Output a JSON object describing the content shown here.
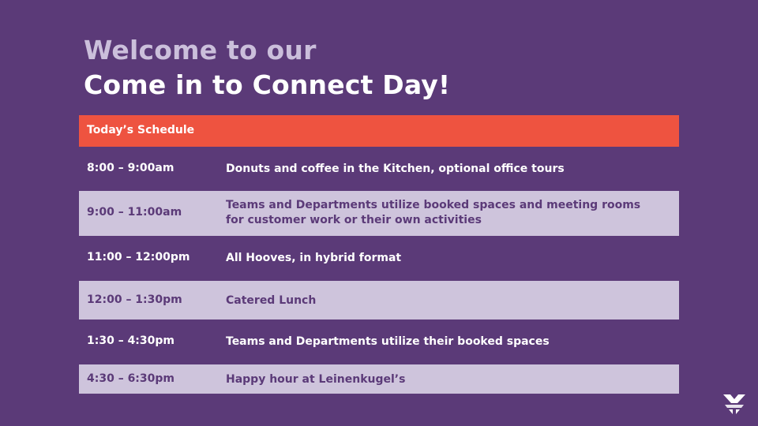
{
  "title": {
    "line1": "Welcome to our",
    "line2": "Come in to Connect Day!"
  },
  "schedule": {
    "header": "Today’s Schedule",
    "rows": [
      {
        "time": "8:00 – 9:00am",
        "activity": "Donuts and coffee in the Kitchen, optional office tours"
      },
      {
        "time": "9:00 – 11:00am",
        "activity": "Teams and Departments utilize booked spaces and meeting rooms for customer work or their own activities"
      },
      {
        "time": "11:00 – 12:00pm",
        "activity": "All Hooves, in hybrid format"
      },
      {
        "time": "12:00 – 1:30pm",
        "activity": "Catered Lunch"
      },
      {
        "time": "1:30 – 4:30pm",
        "activity": "Teams and Departments utilize their booked spaces"
      },
      {
        "time": "4:30 – 6:30pm",
        "activity": "Happy hour at Leinenkugel’s"
      }
    ]
  },
  "colors": {
    "background": "#5b3a78",
    "header_accent": "#ee5340",
    "light_row": "#cec4dc",
    "title_muted": "#cbbfdb"
  },
  "logo": {
    "icon": "company-logo-icon"
  }
}
